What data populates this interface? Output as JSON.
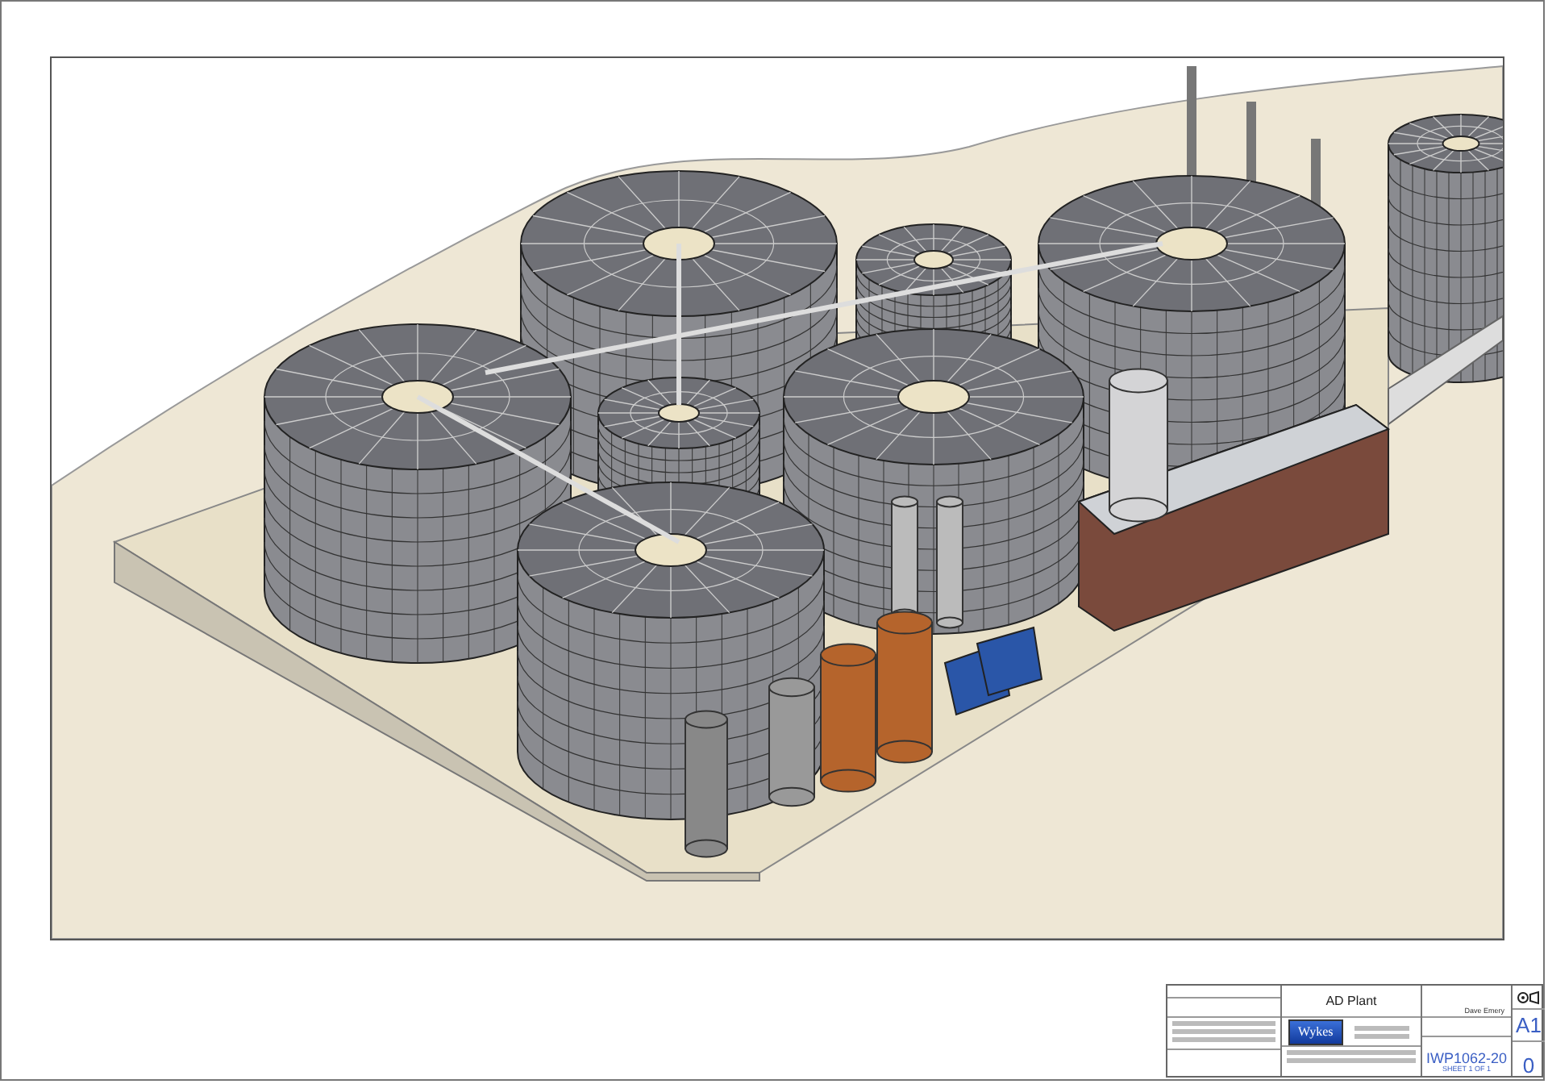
{
  "drawing_sheet": {
    "title_block": {
      "title": "AD Plant",
      "logo": "Wykes",
      "drawn_by": "Dave Emery",
      "sheet_size": "A1",
      "drawing_number": "IWP1062-20",
      "sheet": "SHEET 1 OF 1",
      "issue": "0"
    }
  }
}
